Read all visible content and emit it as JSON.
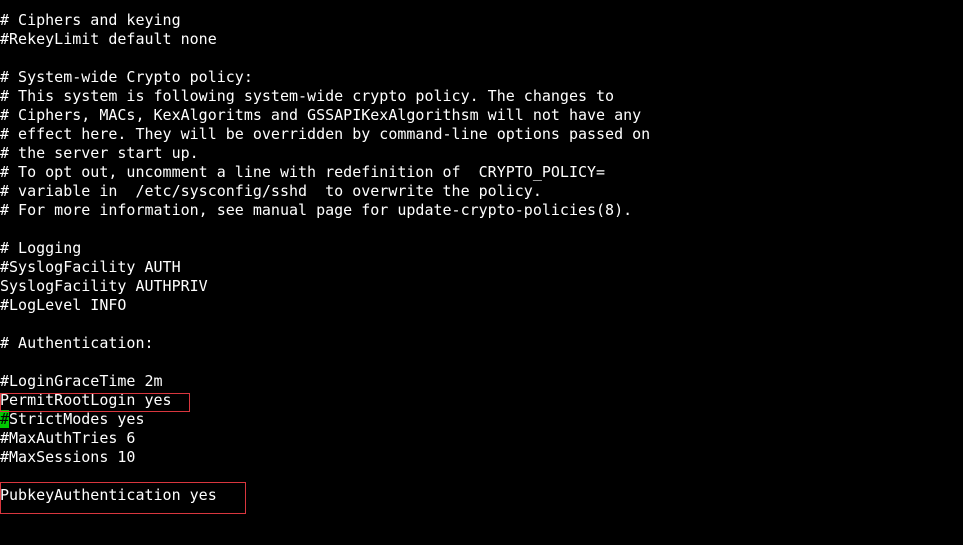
{
  "terminal": {
    "lines": [
      "# Ciphers and keying",
      "#RekeyLimit default none",
      "",
      "# System-wide Crypto policy:",
      "# This system is following system-wide crypto policy. The changes to",
      "# Ciphers, MACs, KexAlgoritms and GSSAPIKexAlgorithsm will not have any",
      "# effect here. They will be overridden by command-line options passed on",
      "# the server start up.",
      "# To opt out, uncomment a line with redefinition of  CRYPTO_POLICY=",
      "# variable in  /etc/sysconfig/sshd  to overwrite the policy.",
      "# For more information, see manual page for update-crypto-policies(8).",
      "",
      "# Logging",
      "#SyslogFacility AUTH",
      "SyslogFacility AUTHPRIV",
      "#LogLevel INFO",
      "",
      "# Authentication:",
      "",
      "#LoginGraceTime 2m",
      "PermitRootLogin yes",
      "",
      "#MaxAuthTries 6",
      "#MaxSessions 10",
      "",
      "PubkeyAuthentication yes"
    ],
    "cursor_char": "#",
    "cursor_line_rest": "StrictModes yes",
    "colors": {
      "background": "#000000",
      "text": "#ffffff",
      "cursor": "#00c800",
      "highlight_box": "#d9363e"
    }
  }
}
